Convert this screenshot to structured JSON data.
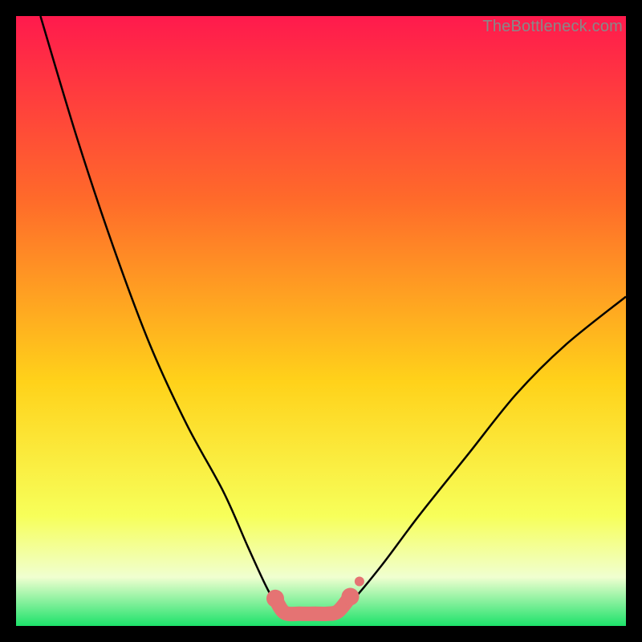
{
  "watermark": "TheBottleneck.com",
  "colors": {
    "black": "#000000",
    "grad_top": "#ff1a4d",
    "grad_upper": "#ff6a2a",
    "grad_mid": "#ffd21a",
    "grad_lower": "#f7ff5a",
    "grad_pale": "#f0ffd0",
    "grad_green": "#1de26a",
    "curve": "#000000",
    "marker_fill": "#e57373",
    "marker_stroke": "#d85c5c"
  },
  "chart_data": {
    "type": "line",
    "title": "",
    "xlabel": "",
    "ylabel": "",
    "xlim": [
      0,
      100
    ],
    "ylim": [
      0,
      100
    ],
    "series": [
      {
        "name": "left-curve",
        "x": [
          4,
          10,
          16,
          22,
          28,
          34,
          38,
          41,
          43,
          44.5
        ],
        "values": [
          100,
          80,
          62,
          46,
          33,
          22,
          13,
          6.5,
          3,
          2
        ]
      },
      {
        "name": "flat-bottom",
        "x": [
          44.5,
          52.5
        ],
        "values": [
          2,
          2
        ]
      },
      {
        "name": "right-curve",
        "x": [
          52.5,
          55,
          60,
          66,
          74,
          82,
          90,
          100
        ],
        "values": [
          2,
          4,
          10,
          18,
          28,
          38,
          46,
          54
        ]
      }
    ],
    "markers": [
      {
        "name": "left-entry",
        "x": 42.5,
        "y": 4.5
      },
      {
        "name": "left-inner",
        "x": 44.0,
        "y": 2.2
      },
      {
        "name": "bottom-a",
        "x": 46.5,
        "y": 2.0
      },
      {
        "name": "bottom-b",
        "x": 49.0,
        "y": 2.0
      },
      {
        "name": "bottom-c",
        "x": 51.0,
        "y": 2.0
      },
      {
        "name": "right-inner",
        "x": 52.8,
        "y": 2.4
      },
      {
        "name": "right-exit",
        "x": 54.8,
        "y": 4.8
      }
    ]
  }
}
